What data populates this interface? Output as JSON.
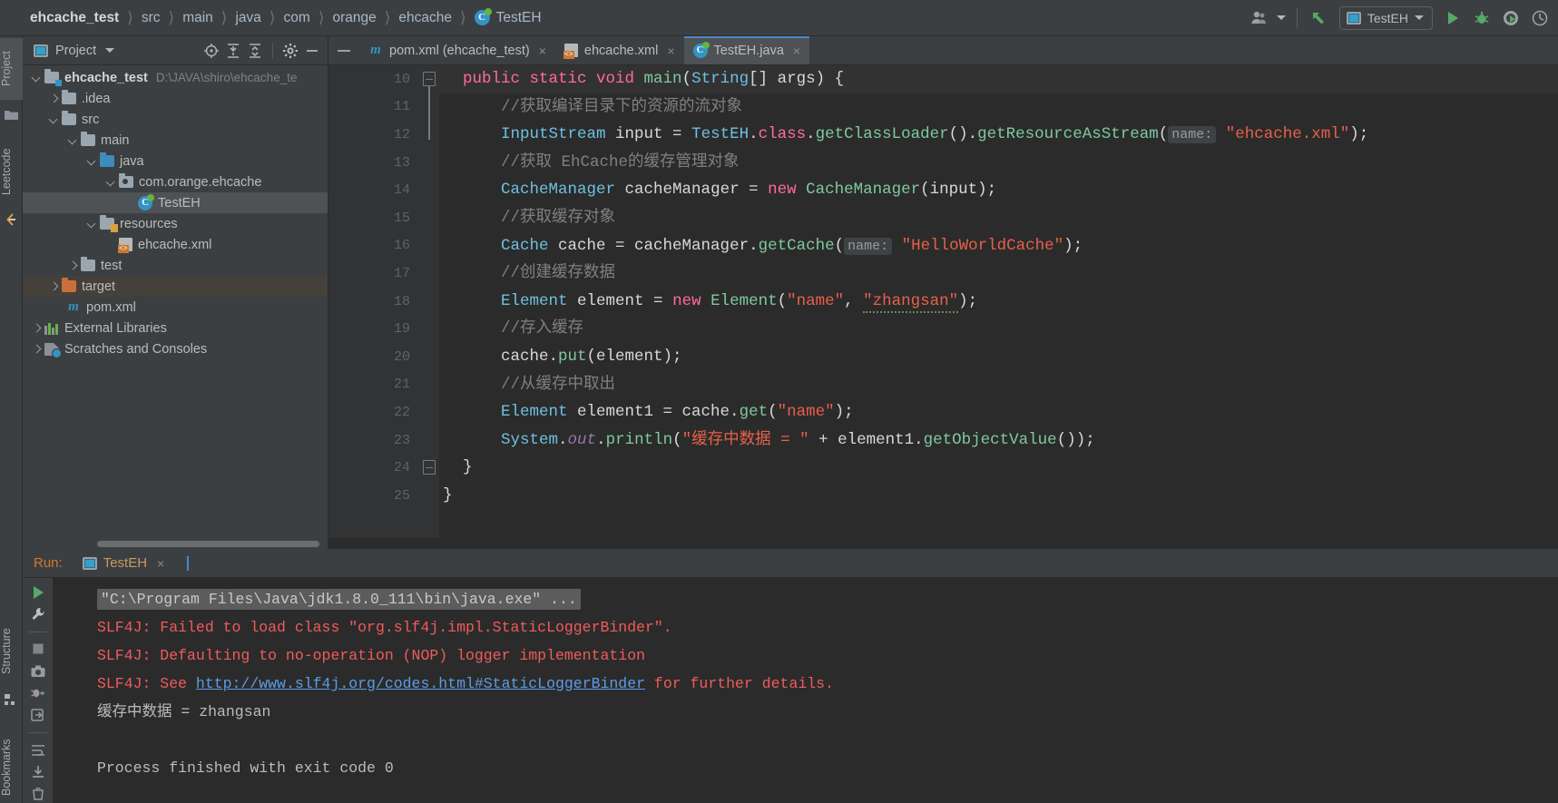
{
  "window": {
    "breadcrumb": [
      {
        "label": "ehcache_test",
        "icon": "",
        "root": true
      },
      {
        "label": "src",
        "icon": ""
      },
      {
        "label": "main",
        "icon": ""
      },
      {
        "label": "java",
        "icon": ""
      },
      {
        "label": "com",
        "icon": ""
      },
      {
        "label": "orange",
        "icon": ""
      },
      {
        "label": "ehcache",
        "icon": ""
      },
      {
        "label": "TestEH",
        "icon": "java-class-icon"
      }
    ],
    "toolbar_right": {
      "account_icon": "user-account-icon",
      "account_caret": "chevron-down-icon",
      "update_icon": "vcs-update-arrow-icon",
      "run_config_name": "TestEH",
      "run_config_icon": "run-configuration-icon",
      "run_config_caret": "chevron-down-icon",
      "run_icon": "run-play-icon",
      "debug_icon": "debug-bug-icon",
      "coverage_icon": "run-with-coverage-icon",
      "profile_icon": "profiler-icon"
    }
  },
  "left_strip": {
    "tabs": [
      {
        "label": "Project",
        "selected": true
      },
      {
        "label": "Leetcode",
        "selected": false
      }
    ],
    "icons": [
      "folder-icon",
      "leetcode-icon"
    ],
    "bottom_tabs": [
      {
        "label": "Structure"
      },
      {
        "label": "Bookmarks"
      }
    ]
  },
  "project_panel": {
    "title": "Project",
    "title_caret": "chevron-down-icon",
    "actions": [
      {
        "name": "select-opened-file-icon"
      },
      {
        "name": "expand-all-icon"
      },
      {
        "name": "collapse-all-icon"
      },
      {
        "name": "settings-gear-icon"
      },
      {
        "name": "hide-panel-icon"
      }
    ],
    "tree": [
      {
        "indent": 0,
        "arrow": "down",
        "icon": "module-folder-icon",
        "label": "ehcache_test",
        "bold": true,
        "path": "D:\\JAVA\\shiro\\ehcache_te",
        "state": "normal"
      },
      {
        "indent": 1,
        "arrow": "right",
        "icon": "folder-icon",
        "label": ".idea",
        "state": "normal"
      },
      {
        "indent": 1,
        "arrow": "down",
        "icon": "folder-icon",
        "label": "src",
        "state": "normal"
      },
      {
        "indent": 2,
        "arrow": "down",
        "icon": "folder-icon",
        "label": "main",
        "state": "normal"
      },
      {
        "indent": 3,
        "arrow": "down",
        "icon": "source-folder-icon",
        "label": "java",
        "state": "normal"
      },
      {
        "indent": 4,
        "arrow": "down",
        "icon": "package-icon",
        "label": "com.orange.ehcache",
        "state": "normal"
      },
      {
        "indent": 5,
        "arrow": "none",
        "icon": "java-class-icon",
        "label": "TestEH",
        "state": "selected"
      },
      {
        "indent": 4,
        "arrow": "down",
        "icon": "resources-folder-icon",
        "label": "resources",
        "state": "normal"
      },
      {
        "indent": 5,
        "arrow": "none",
        "icon": "xml-file-icon",
        "label": "ehcache.xml",
        "state": "normal"
      },
      {
        "indent": 3,
        "arrow": "right",
        "icon": "folder-icon",
        "label": "test",
        "state": "normal"
      },
      {
        "indent": 2,
        "arrow": "right",
        "icon": "excluded-folder-icon",
        "label": "target",
        "state": "highlighted"
      },
      {
        "indent": 2,
        "arrow": "none",
        "icon": "maven-icon",
        "label": "pom.xml",
        "state": "normal"
      },
      {
        "indent": 0,
        "arrow": "right",
        "icon": "libraries-icon",
        "label": "External Libraries",
        "state": "normal"
      },
      {
        "indent": 0,
        "arrow": "right",
        "icon": "scratches-icon",
        "label": "Scratches and Consoles",
        "state": "normal"
      }
    ]
  },
  "editor": {
    "collapse_icon": "collapse-editor-icon",
    "tabs": [
      {
        "label": "pom.xml (ehcache_test)",
        "icon": "maven-icon",
        "active": false,
        "close": "×"
      },
      {
        "label": "ehcache.xml",
        "icon": "xml-file-icon",
        "active": false,
        "close": "×"
      },
      {
        "label": "TestEH.java",
        "icon": "java-class-icon",
        "active": true,
        "close": "×"
      }
    ],
    "line_numbers": [
      "10",
      "11",
      "12",
      "13",
      "14",
      "15",
      "16",
      "17",
      "18",
      "19",
      "20",
      "21",
      "22",
      "23",
      "24",
      "25"
    ],
    "run_gutter_icon": "run-play-gutter-icon",
    "code_lines": [
      {
        "n": 10,
        "highlight": true,
        "segments": [
          {
            "t": "public ",
            "c": "kw2"
          },
          {
            "t": "static ",
            "c": "kw2"
          },
          {
            "t": "void ",
            "c": "kw2"
          },
          {
            "t": "main",
            "c": "typ2"
          },
          {
            "t": "(",
            "c": "pln"
          },
          {
            "t": "String",
            "c": "typ"
          },
          {
            "t": "[] args) {",
            "c": "pln"
          }
        ]
      },
      {
        "n": 11,
        "indent": 1,
        "segments": [
          {
            "t": "//获取编译目录下的资源的流对象",
            "c": "cmt"
          }
        ]
      },
      {
        "n": 12,
        "indent": 1,
        "segments": [
          {
            "t": "InputStream",
            "c": "typ"
          },
          {
            "t": " input = ",
            "c": "pln"
          },
          {
            "t": "TestEH",
            "c": "typ"
          },
          {
            "t": ".",
            "c": "pln"
          },
          {
            "t": "class",
            "c": "kw2"
          },
          {
            "t": ".",
            "c": "pln"
          },
          {
            "t": "getClassLoader",
            "c": "typ2"
          },
          {
            "t": "().",
            "c": "pln"
          },
          {
            "t": "getResourceAsStream",
            "c": "typ2"
          },
          {
            "t": "(",
            "c": "pln"
          },
          {
            "t": "name:",
            "c": "hint"
          },
          {
            "t": " ",
            "c": "pln"
          },
          {
            "t": "\"ehcache.xml\"",
            "c": "str"
          },
          {
            "t": ");",
            "c": "pln"
          }
        ]
      },
      {
        "n": 13,
        "indent": 1,
        "segments": [
          {
            "t": "//获取 EhCache的缓存管理对象",
            "c": "cmt"
          }
        ]
      },
      {
        "n": 14,
        "indent": 1,
        "segments": [
          {
            "t": "CacheManager",
            "c": "typ"
          },
          {
            "t": " cacheManager = ",
            "c": "pln"
          },
          {
            "t": "new ",
            "c": "kw2"
          },
          {
            "t": "CacheManager",
            "c": "typ2"
          },
          {
            "t": "(input);",
            "c": "pln"
          }
        ]
      },
      {
        "n": 15,
        "indent": 1,
        "segments": [
          {
            "t": "//获取缓存对象",
            "c": "cmt"
          }
        ]
      },
      {
        "n": 16,
        "indent": 1,
        "segments": [
          {
            "t": "Cache",
            "c": "typ"
          },
          {
            "t": " cache = cacheManager.",
            "c": "pln"
          },
          {
            "t": "getCache",
            "c": "typ2"
          },
          {
            "t": "(",
            "c": "pln"
          },
          {
            "t": "name:",
            "c": "hint"
          },
          {
            "t": " ",
            "c": "pln"
          },
          {
            "t": "\"HelloWorldCache\"",
            "c": "str"
          },
          {
            "t": ");",
            "c": "pln"
          }
        ]
      },
      {
        "n": 17,
        "indent": 1,
        "segments": [
          {
            "t": "//创建缓存数据",
            "c": "cmt"
          }
        ]
      },
      {
        "n": 18,
        "indent": 1,
        "segments": [
          {
            "t": "Element",
            "c": "typ"
          },
          {
            "t": " element = ",
            "c": "pln"
          },
          {
            "t": "new ",
            "c": "kw2"
          },
          {
            "t": "Element",
            "c": "typ2"
          },
          {
            "t": "(",
            "c": "pln"
          },
          {
            "t": "\"name\"",
            "c": "str"
          },
          {
            "t": ", ",
            "c": "pln"
          },
          {
            "t": "\"zhangsan\"",
            "c": "str wavy"
          },
          {
            "t": ");",
            "c": "pln"
          }
        ]
      },
      {
        "n": 19,
        "indent": 1,
        "segments": [
          {
            "t": "//存入缓存",
            "c": "cmt"
          }
        ]
      },
      {
        "n": 20,
        "indent": 1,
        "segments": [
          {
            "t": "cache.",
            "c": "pln"
          },
          {
            "t": "put",
            "c": "typ2"
          },
          {
            "t": "(element);",
            "c": "pln"
          }
        ]
      },
      {
        "n": 21,
        "indent": 1,
        "segments": [
          {
            "t": "//从缓存中取出",
            "c": "cmt"
          }
        ]
      },
      {
        "n": 22,
        "indent": 1,
        "segments": [
          {
            "t": "Element",
            "c": "typ"
          },
          {
            "t": " element1 = cache.",
            "c": "pln"
          },
          {
            "t": "get",
            "c": "typ2"
          },
          {
            "t": "(",
            "c": "pln"
          },
          {
            "t": "\"name\"",
            "c": "str"
          },
          {
            "t": ");",
            "c": "pln"
          }
        ]
      },
      {
        "n": 23,
        "indent": 1,
        "segments": [
          {
            "t": "System",
            "c": "typ"
          },
          {
            "t": ".",
            "c": "pln"
          },
          {
            "t": "out",
            "c": "fld itl"
          },
          {
            "t": ".",
            "c": "pln"
          },
          {
            "t": "println",
            "c": "typ2"
          },
          {
            "t": "(",
            "c": "pln"
          },
          {
            "t": "\"缓存中数据 = \"",
            "c": "str"
          },
          {
            "t": " + element1.",
            "c": "pln"
          },
          {
            "t": "getObjectValue",
            "c": "typ2"
          },
          {
            "t": "());",
            "c": "pln"
          }
        ]
      },
      {
        "n": 24,
        "segments": [
          {
            "t": "    }",
            "c": "pln"
          }
        ]
      },
      {
        "n": 25,
        "segments": [
          {
            "t": "}",
            "c": "pln"
          }
        ]
      }
    ]
  },
  "run_panel": {
    "label": "Run:",
    "tab": {
      "label": "TestEH",
      "icon": "run-configuration-icon",
      "close": "×"
    },
    "toolbar": [
      {
        "name": "rerun-icon"
      },
      {
        "name": "settings-wrench-icon"
      },
      {
        "name": "stop-icon"
      },
      {
        "name": "print-snapshot-icon"
      },
      {
        "name": "dump-threads-icon"
      },
      {
        "name": "scroll-to-end-icon"
      },
      {
        "name": "soft-wrap-icon"
      },
      {
        "name": "download-icon"
      },
      {
        "name": "delete-icon"
      }
    ],
    "output": [
      {
        "type": "command",
        "text": "\"C:\\Program Files\\Java\\jdk1.8.0_111\\bin\\java.exe\" ..."
      },
      {
        "type": "error",
        "text": "SLF4J: Failed to load class \"org.slf4j.impl.StaticLoggerBinder\"."
      },
      {
        "type": "error",
        "text": "SLF4J: Defaulting to no-operation (NOP) logger implementation"
      },
      {
        "type": "error-link",
        "pre": "SLF4J: See ",
        "link": "http://www.slf4j.org/codes.html#StaticLoggerBinder",
        "post": " for further details."
      },
      {
        "type": "stdout",
        "text": "缓存中数据 = zhangsan"
      },
      {
        "type": "blank",
        "text": " "
      },
      {
        "type": "stdout",
        "text": "Process finished with exit code 0"
      }
    ]
  },
  "colors": {
    "panel_bg": "#3c3f41",
    "editor_bg": "#2b2b2b",
    "gutter_bg": "#313335",
    "selection_bg": "#4e5254",
    "accent_blue": "#3592c4",
    "accent_green": "#62b543",
    "error_red": "#f05b5b",
    "string_orange": "#e8604a",
    "keyword_pink": "#ff6b9d",
    "comment_grey": "#808080",
    "link_blue": "#5c9ce6"
  }
}
